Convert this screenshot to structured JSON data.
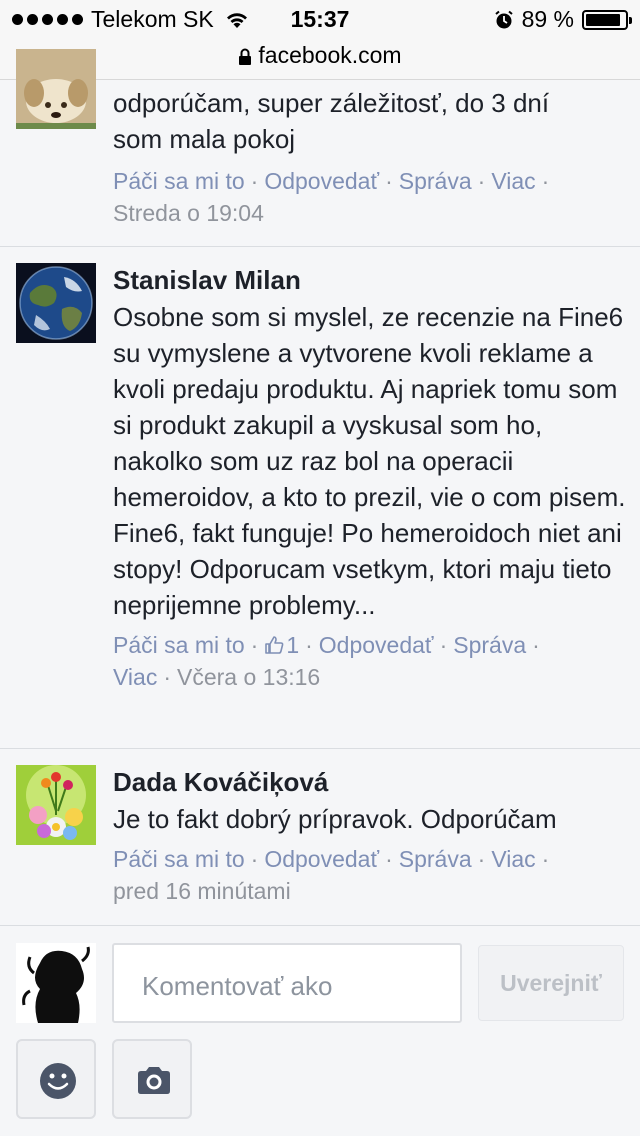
{
  "status_bar": {
    "carrier": "Telekom SK",
    "time": "15:37",
    "battery_text": "89 %",
    "battery_level": 0.89,
    "icons": [
      "signal-dots-icon",
      "wifi-icon",
      "alarm-icon",
      "battery-icon"
    ]
  },
  "url_bar": {
    "domain": "facebook.com",
    "icon": "lock-icon"
  },
  "comments": [
    {
      "name": "",
      "text_line1": "odporúčam, super záležitosť, do 3 dní",
      "text_line2": "som mala pokoj",
      "actions": {
        "like": "Páči sa mi to",
        "reply": "Odpovedať",
        "message": "Správa",
        "more": "Viac"
      },
      "time": "Streda o 19:04"
    },
    {
      "name": "Stanislav Milan",
      "text": "Osobne som si myslel, ze recenzie na Fine6 su vymyslene a vytvorene kvoli reklame a kvoli predaju produktu. Aj napriek tomu som si produkt zakupil a vyskusal som ho, nakolko som uz raz bol na operacii hemeroidov, a kto to prezil, vie o com pisem. Fine6, fakt funguje! Po hemeroidoch niet ani stopy! Odporucam vsetkym, ktori maju tieto neprijemne problemy...",
      "actions": {
        "like": "Páči sa mi to",
        "like_count": "1",
        "reply": "Odpovedať",
        "message": "Správa",
        "more": "Viac"
      },
      "time": "Včera o 13:16"
    },
    {
      "name": "Dada Kováčiķová",
      "text": "Je to fakt dobrý prípravok. Odporúčam",
      "actions": {
        "like": "Páči sa mi to",
        "reply": "Odpovedať",
        "message": "Správa",
        "more": "Viac"
      },
      "time": "pred 16 minútami"
    }
  ],
  "composer": {
    "placeholder": "Komentovať ako",
    "post_label": "Uverejniť",
    "emoji_icon": "smiley-icon",
    "camera_icon": "camera-icon"
  },
  "colors": {
    "name": "#1d2129",
    "action_link": "#7f8fb5",
    "meta": "#90949c",
    "background": "#f5f6f8"
  }
}
